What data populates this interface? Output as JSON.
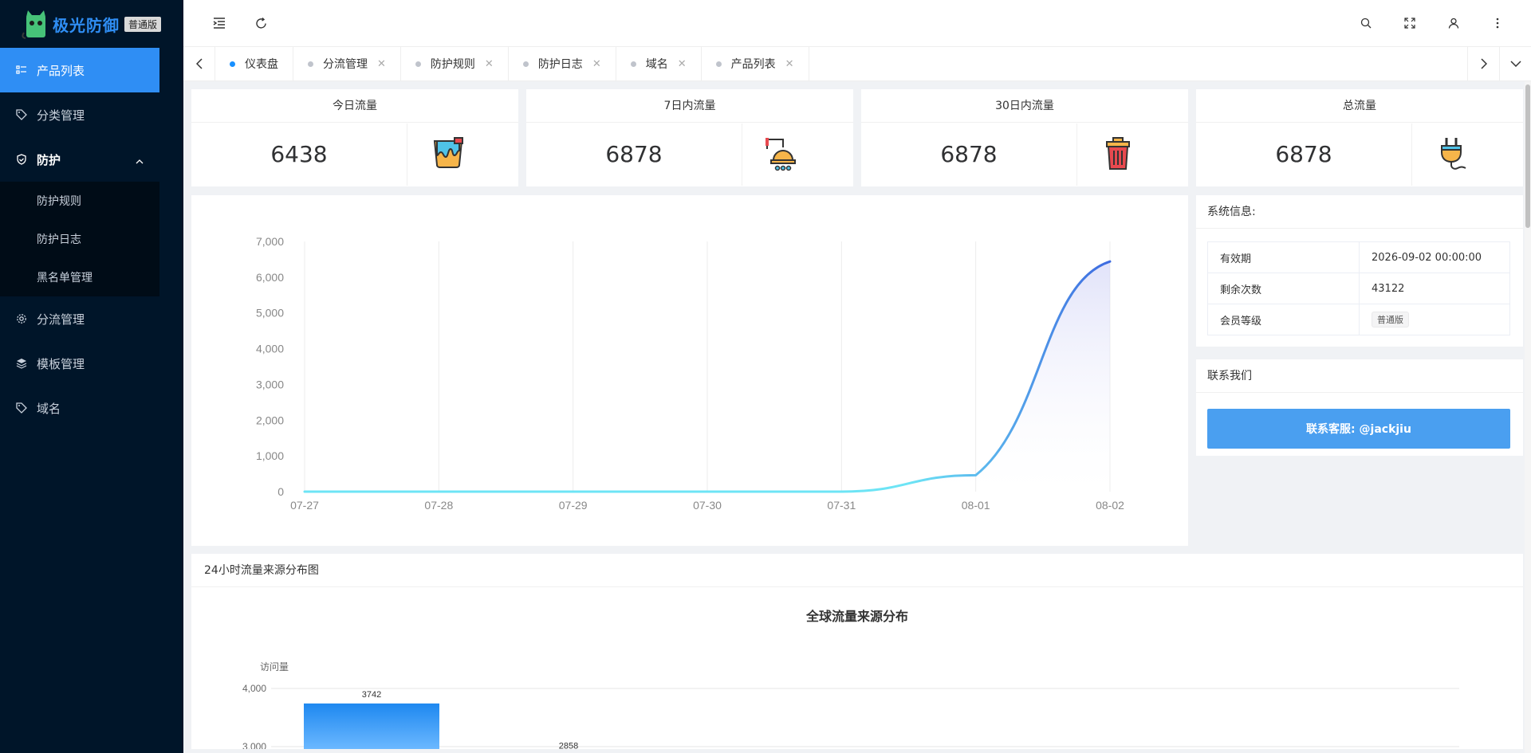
{
  "app": {
    "name": "极光防御",
    "badge": "普通版"
  },
  "sidebar": {
    "items": [
      {
        "label": "产品列表",
        "icon": "list-icon",
        "active": true
      },
      {
        "label": "分类管理",
        "icon": "tag-icon"
      },
      {
        "label": "防护",
        "icon": "shield-icon",
        "open": true,
        "children": [
          "防护规则",
          "防护日志",
          "黑名单管理"
        ]
      },
      {
        "label": "分流管理",
        "icon": "gear-icon"
      },
      {
        "label": "模板管理",
        "icon": "layers-icon"
      },
      {
        "label": "域名",
        "icon": "tag-icon"
      }
    ]
  },
  "tabs": [
    {
      "label": "仪表盘",
      "active": true,
      "closable": false
    },
    {
      "label": "分流管理",
      "closable": true
    },
    {
      "label": "防护规则",
      "closable": true
    },
    {
      "label": "防护日志",
      "closable": true
    },
    {
      "label": "域名",
      "closable": true
    },
    {
      "label": "产品列表",
      "closable": true
    }
  ],
  "stats": [
    {
      "title": "今日流量",
      "value": "6438",
      "icon": "paint-bucket-icon"
    },
    {
      "title": "7日内流量",
      "value": "6878",
      "icon": "lamp-icon"
    },
    {
      "title": "30日内流量",
      "value": "6878",
      "icon": "trash-can-icon"
    },
    {
      "title": "总流量",
      "value": "6878",
      "icon": "plug-icon"
    }
  ],
  "system_info": {
    "title": "系统信息:",
    "rows": [
      {
        "label": "有效期",
        "value": "2026-09-02 00:00:00"
      },
      {
        "label": "剩余次数",
        "value": "43122"
      },
      {
        "label": "会员等级",
        "value": "普通版"
      }
    ]
  },
  "contact": {
    "title": "联系我们",
    "button": "联系客服: @jackjiu"
  },
  "chart_data": [
    {
      "type": "area",
      "x": [
        "07-27",
        "07-28",
        "07-29",
        "07-30",
        "07-31",
        "08-01",
        "08-02"
      ],
      "values": [
        0,
        0,
        0,
        0,
        0,
        460,
        6438
      ],
      "ylim": [
        0,
        7000
      ],
      "yticks": [
        "0",
        "1,000",
        "2,000",
        "3,000",
        "4,000",
        "5,000",
        "6,000",
        "7,000"
      ],
      "grid": "vertical",
      "colors": {
        "line_start": "#6de4f5",
        "line_end": "#3d6ae0",
        "axis": "#888888"
      }
    },
    {
      "type": "bar",
      "panel_title": "24小时流量来源分布图",
      "title": "全球流量来源分布",
      "ylabel": "访问量",
      "values": [
        3742,
        2858
      ],
      "yticks": [
        "3,000",
        "4,000"
      ],
      "colors": {
        "bar_top": "#1e88f0",
        "bar_bottom": "#6bb8ff"
      }
    }
  ]
}
